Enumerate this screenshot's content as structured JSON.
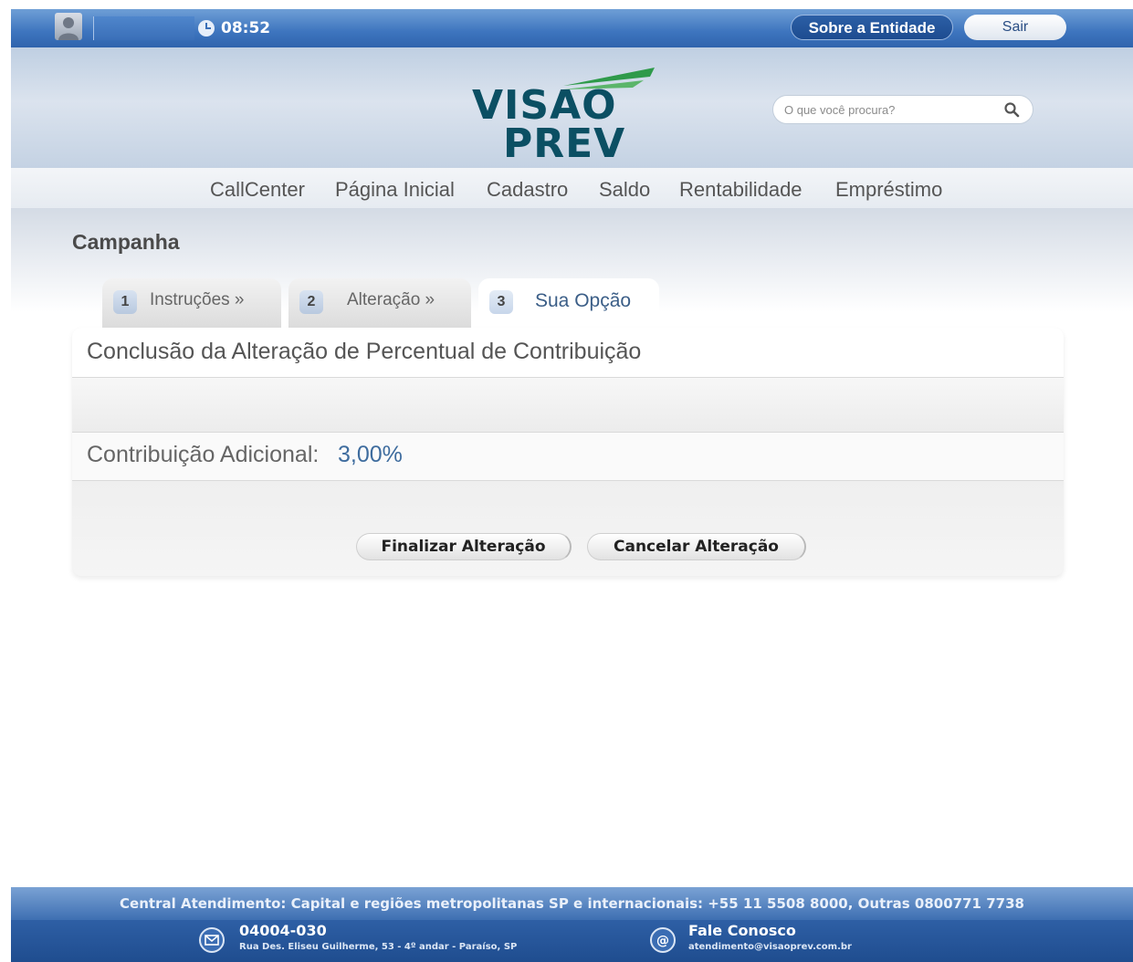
{
  "topbar": {
    "time": "08:52",
    "entidade_label": "Sobre a Entidade",
    "sair_label": "Sair"
  },
  "header": {
    "logo_line1": "VISAO",
    "logo_line2": "PREV",
    "search_placeholder": "O que você procura?"
  },
  "nav": [
    "CallCenter",
    "Página Inicial",
    "Cadastro",
    "Saldo",
    "Rentabilidade",
    "Empréstimo"
  ],
  "page": {
    "title": "Campanha",
    "tabs": [
      {
        "num": "1",
        "label": "Instruções »"
      },
      {
        "num": "2",
        "label": "Alteração »"
      },
      {
        "num": "3",
        "label": "Sua Opção"
      }
    ],
    "panel_title": "Conclusão da Alteração de Percentual de Contribuição",
    "contrib_label": "Contribuição Adicional:",
    "contrib_value": "3,00%",
    "finalize_label": "Finalizar Alteração",
    "cancel_label": "Cancelar Alteração"
  },
  "footer": {
    "central": "Central Atendimento: Capital e regiões metropolitanas SP e internacionais: +55 11 5508 8000, Outras 0800771 7738",
    "cep": "04004-030",
    "address": "Rua Des. Eliseu Guilherme, 53 - 4º andar - Paraíso, SP",
    "contact_title": "Fale Conosco",
    "email": "atendimento@visaoprev.com.br"
  },
  "colors": {
    "topbar": "#3d74be",
    "logo": "#0b4f63",
    "logo_stripe": "#2e9a4a",
    "accent_value": "#3e6c9e"
  }
}
